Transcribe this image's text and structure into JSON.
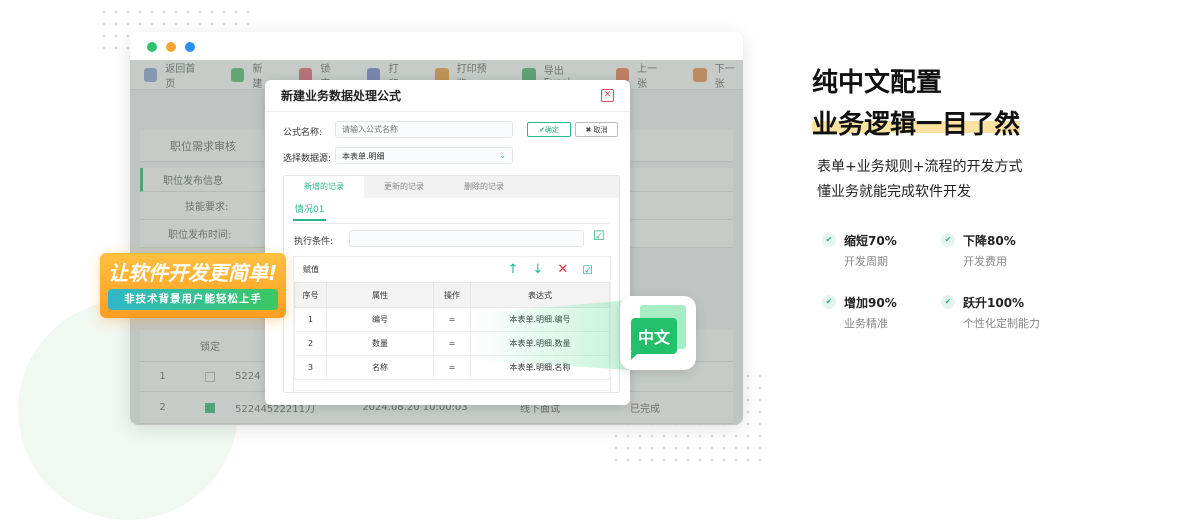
{
  "window": {
    "toolbar": [
      "返回首页",
      "新建",
      "锁定",
      "打印",
      "打印预览",
      "导出Excel",
      "上一张",
      "下一张"
    ],
    "bg": {
      "page_title": "职位需求审核",
      "section": "职位发布信息",
      "field1": "技能要求:",
      "field2": "职位发布时间:",
      "lock_header": "锁定",
      "rows": [
        {
          "no": "1",
          "id": "5224"
        },
        {
          "no": "2",
          "id": "52244522211刀",
          "time": "2024.08.20 10:00:03",
          "type": "线下面试",
          "status": "已完成"
        }
      ]
    }
  },
  "modal": {
    "title": "新建业务数据处理公式",
    "name_label": "公式名称:",
    "name_placeholder": "请输入公式名称",
    "ok": "✔确定",
    "cancel": "✖ 取消",
    "source_label": "选择数据源:",
    "source_value": "本表单.明细",
    "tabs": [
      "新增的记录",
      "更新的记录",
      "删除的记录"
    ],
    "subtab": "情况01",
    "cond_label": "执行条件:",
    "assign_title": "赋值",
    "columns": [
      "序号",
      "属性",
      "操作",
      "表达式"
    ],
    "rows": [
      [
        "1",
        "编号",
        "=",
        "本表单.明细.编号"
      ],
      [
        "2",
        "数量",
        "=",
        "本表单.明细.数量"
      ],
      [
        "3",
        "名称",
        "=",
        "本表单.明细.名称"
      ]
    ]
  },
  "badge": {
    "title": "让软件开发更简单!",
    "subtitle": "非技术背景用户能轻松上手"
  },
  "bubble": {
    "text": "中文"
  },
  "right": {
    "title1": "纯中文配置",
    "title2": "业务逻辑一目了然",
    "line1": "表单+业务规则+流程的开发方式",
    "line2": "懂业务就能完成软件开发",
    "features": [
      {
        "main": "缩短70%",
        "sub": "开发周期"
      },
      {
        "main": "下降80%",
        "sub": "开发费用"
      },
      {
        "main": "增加90%",
        "sub": "业务精准"
      },
      {
        "main": "跃升100%",
        "sub": "个性化定制能力"
      }
    ]
  },
  "colors": {
    "accent": "#2bb58a",
    "highlight": "#fbe2a0",
    "orange": "#ff9d20"
  }
}
